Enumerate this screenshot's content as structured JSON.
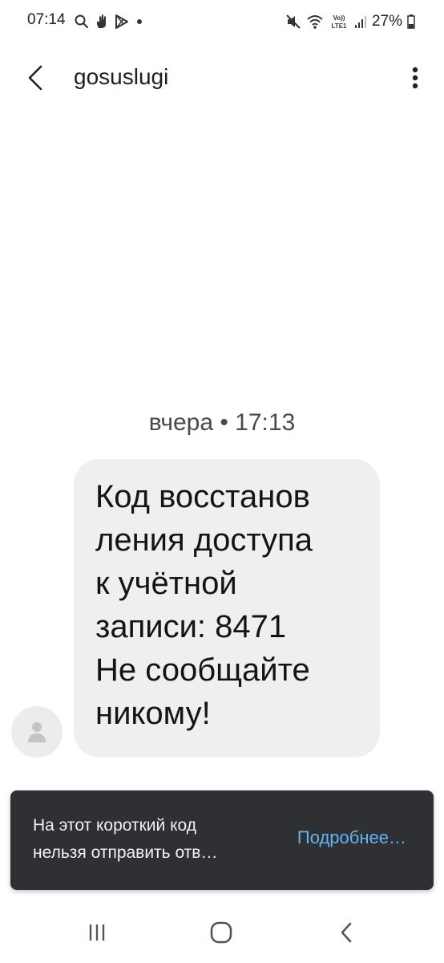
{
  "status_bar": {
    "time": "07:14",
    "battery": "27%",
    "left_icons": [
      "search-icon",
      "hand-icon",
      "play-store-icon",
      "notification-dot-icon"
    ],
    "right_icons": [
      "mute-icon",
      "wifi-icon",
      "volte-lte-icon",
      "signal-icon",
      "battery-icon"
    ]
  },
  "app_bar": {
    "contact_name": "gosuslugi"
  },
  "conversation": {
    "date_separator": "вчера • 17:13",
    "message_text": "Код восстанов\nления доступа\nк учётной\nзаписи: 8471\nНе сообщайте\nникому!"
  },
  "snackbar": {
    "text": "На этот короткий код\nнельзя отправить отв…",
    "action_label": "Подробнее…"
  },
  "colors": {
    "bubble_bg": "#efefef",
    "snackbar_bg": "#2e3033",
    "snackbar_action": "#5fb6f0"
  }
}
